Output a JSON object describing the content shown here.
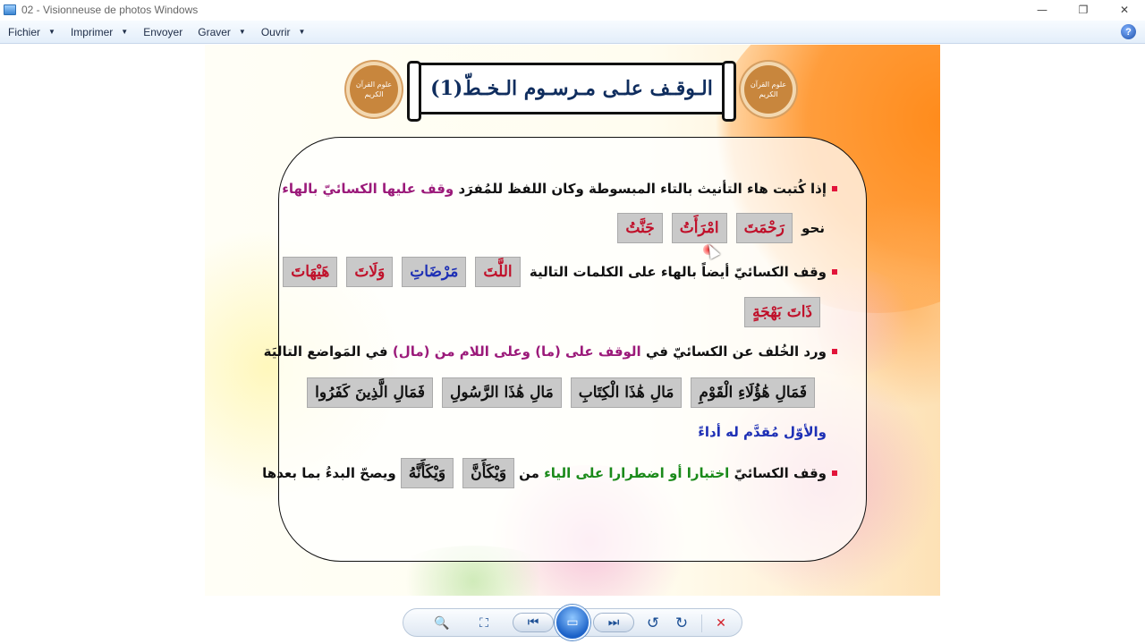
{
  "window": {
    "title": "02 - Visionneuse de photos Windows",
    "controls": {
      "minimize": "—",
      "restore": "❐",
      "close": "✕"
    }
  },
  "menu": {
    "file": "Fichier",
    "print": "Imprimer",
    "send": "Envoyer",
    "burn": "Graver",
    "open": "Ouvrir",
    "help": "?"
  },
  "slide": {
    "title": "الـوقـف علـى مـرسـوم الـخـطّ(1)",
    "badge_text": "علوم القرآن الكريم",
    "bullet1": {
      "text": "إذا كُتبت هاء التأنيث بالتاء المبسوطة وكان اللفظ للمُفرَد",
      "highlight": "وقف عليها الكسائيّ بالهاء"
    },
    "example_prefix": "نحو",
    "examples1": [
      "رَحْمَتَ",
      "امْرَأَتُ",
      "جَنَّتُ"
    ],
    "bullet2": {
      "text": "وقف الكسائيّ أيضاً بالهاء على الكلمات التالية"
    },
    "examples2": [
      "اللَّتَ",
      "مَرْضَاتِ",
      "وَلَاتَ",
      "هَيْهَاتَ"
    ],
    "examples2b": [
      "ذَاتَ بَهْجَةٍ"
    ],
    "bullet3": {
      "part1": "ورد الخُلف عن الكسائيّ في",
      "part2": "الوقف على (ما) وعلى اللام من (مال)",
      "part3": "في المَواضع التاليَة"
    },
    "examples3": [
      "فَمَالِ هَٰؤُلَاءِ الْقَوْمِ",
      "مَالِ هَٰذَا الْكِتَابِ",
      "مَالِ هَٰذَا الرَّسُولِ",
      "فَمَالِ الَّذِينَ كَفَرُوا"
    ],
    "note": "والأوّل مُقدَّم له أداءً",
    "bullet4": {
      "part1": "وقف الكسائيّ",
      "part2": "اختبارا أو اضطرارا على الياء",
      "part3": "من",
      "examples": [
        "وَيْكَأَنَّ",
        "وَيْكَأَنَّهُ"
      ],
      "part4": "ويصحّ البدءُ بما بعدها"
    }
  },
  "colors": {
    "title": "#0f2d5e",
    "purple": "#9b1a7a",
    "blue": "#1d2fb5",
    "green": "#1a8a1a",
    "red": "#c0102a",
    "bullet": "#e2143a"
  },
  "toolbar": {
    "zoom_icon": "🔍",
    "fit_icon": "⛶",
    "prev_icon": "⏮",
    "slideshow_icon": "▭",
    "next_icon": "⏭",
    "rotate_left_icon": "↺",
    "rotate_right_icon": "↻",
    "delete_icon": "✕"
  }
}
